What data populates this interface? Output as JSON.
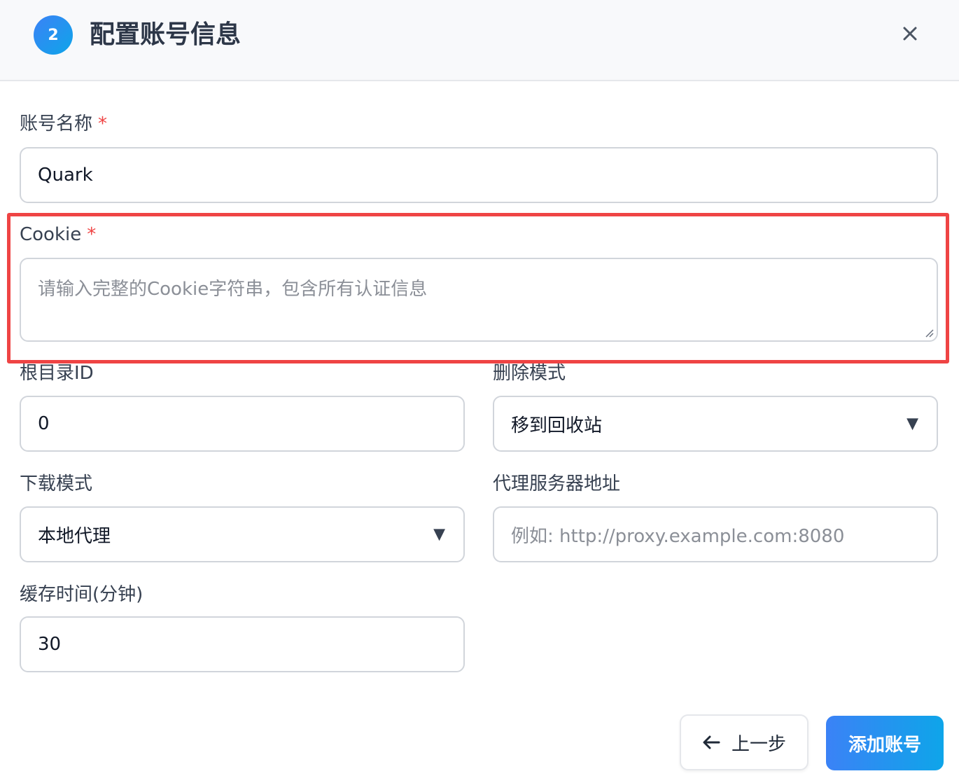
{
  "header": {
    "step_number": "2",
    "title": "配置账号信息",
    "close_icon": "close-icon"
  },
  "form": {
    "account_name": {
      "label": "账号名称",
      "required_mark": "*",
      "value": "Quark"
    },
    "cookie": {
      "label": "Cookie",
      "required_mark": "*",
      "placeholder": "请输入完整的Cookie字符串，包含所有认证信息",
      "value": ""
    },
    "root_dir_id": {
      "label": "根目录ID",
      "value": "0"
    },
    "delete_mode": {
      "label": "删除模式",
      "selected": "移到回收站"
    },
    "download_mode": {
      "label": "下载模式",
      "selected": "本地代理"
    },
    "proxy_address": {
      "label": "代理服务器地址",
      "placeholder": "例如: http://proxy.example.com:8080",
      "value": ""
    },
    "cache_time": {
      "label": "缓存时间(分钟)",
      "value": "30"
    }
  },
  "actions": {
    "back_label": "上一步",
    "add_label": "添加账号"
  },
  "colors": {
    "accent": "#3b82f6",
    "accent_end": "#0ea5e9",
    "required": "#ef4444",
    "highlight_box": "#ef4444"
  }
}
